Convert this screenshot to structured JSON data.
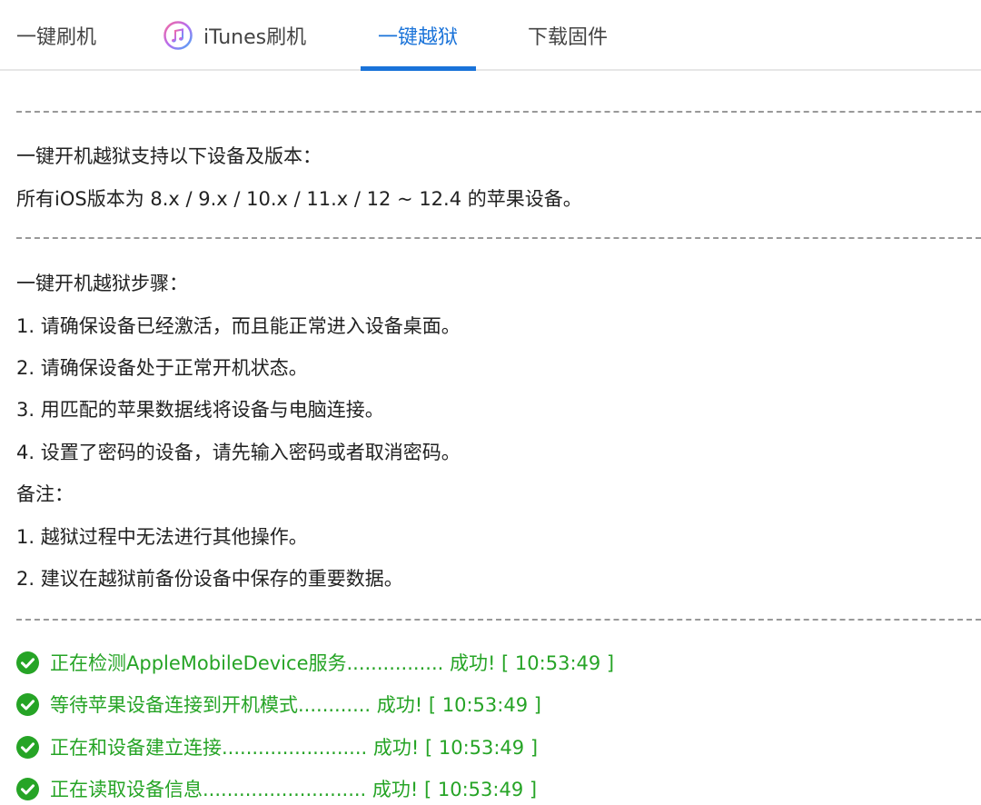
{
  "tabs": {
    "one_click_flash": "一键刷机",
    "itunes_flash": "iTunes刷机",
    "one_click_jailbreak": "一键越狱",
    "download_firmware": "下载固件"
  },
  "support": {
    "heading": "一键开机越狱支持以下设备及版本：",
    "versions": "所有iOS版本为 8.x / 9.x / 10.x / 11.x / 12 ~ 12.4 的苹果设备。"
  },
  "steps": {
    "heading": "一键开机越狱步骤：",
    "items": [
      "1. 请确保设备已经激活，而且能正常进入设备桌面。",
      "2. 请确保设备处于正常开机状态。",
      "3. 用匹配的苹果数据线将设备与电脑连接。",
      "4. 设置了密码的设备，请先输入密码或者取消密码。"
    ]
  },
  "notes": {
    "heading": "备注：",
    "items": [
      "1. 越狱过程中无法进行其他操作。",
      "2. 建议在越狱前备份设备中保存的重要数据。"
    ]
  },
  "log": [
    {
      "text": "正在检测AppleMobileDevice服务................ 成功! [ 10:53:49 ]"
    },
    {
      "text": "等待苹果设备连接到开机模式............ 成功! [ 10:53:49 ]"
    },
    {
      "text": "正在和设备建立连接........................ 成功! [ 10:53:49 ]"
    },
    {
      "text": "正在读取设备信息........................... 成功! [ 10:53:49 ]"
    }
  ],
  "colors": {
    "accent": "#1a73d9",
    "success": "#26a426"
  }
}
